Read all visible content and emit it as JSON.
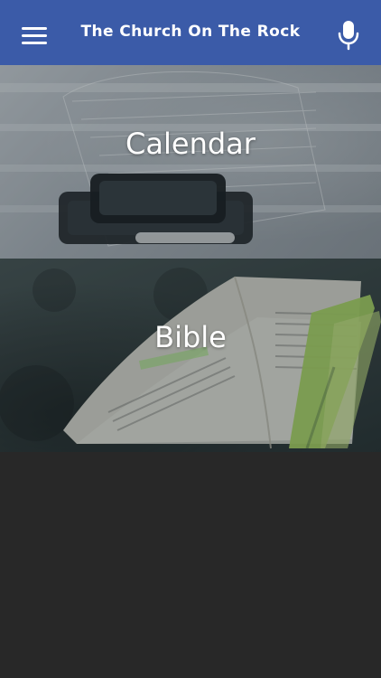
{
  "header": {
    "title": "The Church On The Rock",
    "menu_icon": "hamburger-menu-icon",
    "mic_icon": "microphone-icon",
    "bar_color": "#3b5ba8"
  },
  "tiles": [
    {
      "label": "Calendar"
    },
    {
      "label": "Bible"
    }
  ],
  "background_color": "#282828"
}
